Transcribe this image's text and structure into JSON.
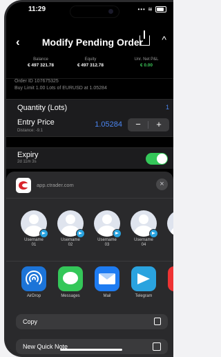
{
  "status_bar": {
    "time": "11:29",
    "icons": "••• ≋"
  },
  "nav": {
    "back_icon": "‹",
    "title": "Modify Pending Order",
    "chevron_icon": "^"
  },
  "balances": [
    {
      "label": "Balance",
      "value": "€ 497 321.78"
    },
    {
      "label": "Equity",
      "value": "€ 497 312.78"
    },
    {
      "label": "Unr. Net P&L",
      "value": "€ 0.00"
    }
  ],
  "order": {
    "id_line": "Order ID 107675325",
    "desc_line": "Buy Limit 1.00 Lots of EURUSD at 1.05284"
  },
  "quantity": {
    "label": "Quantity (Lots)",
    "value": "1"
  },
  "entry_price": {
    "label": "Entry Price",
    "distance": "Distance: -9.1",
    "value": "1.05284",
    "minus": "−",
    "plus": "+"
  },
  "expiry": {
    "label": "Expiry",
    "remaining": "2d 11m 3s",
    "enabled": true
  },
  "share_sheet": {
    "url": "app.ctrader.com",
    "close": "×",
    "contacts": [
      {
        "name": "Username\n01"
      },
      {
        "name": "Username\n02"
      },
      {
        "name": "Username\n03"
      },
      {
        "name": "Username\n04"
      },
      {
        "name": "U"
      }
    ],
    "apps": [
      {
        "label": "AirDrop"
      },
      {
        "label": "Messages"
      },
      {
        "label": "Mail"
      },
      {
        "label": "Telegram"
      },
      {
        "label": ""
      }
    ],
    "actions": [
      {
        "label": "Copy"
      },
      {
        "label": "New Quick Note"
      }
    ]
  },
  "colors": {
    "accent_blue": "#4b86f2",
    "toggle_green": "#34c759",
    "pnl_green": "#3dc75a"
  }
}
